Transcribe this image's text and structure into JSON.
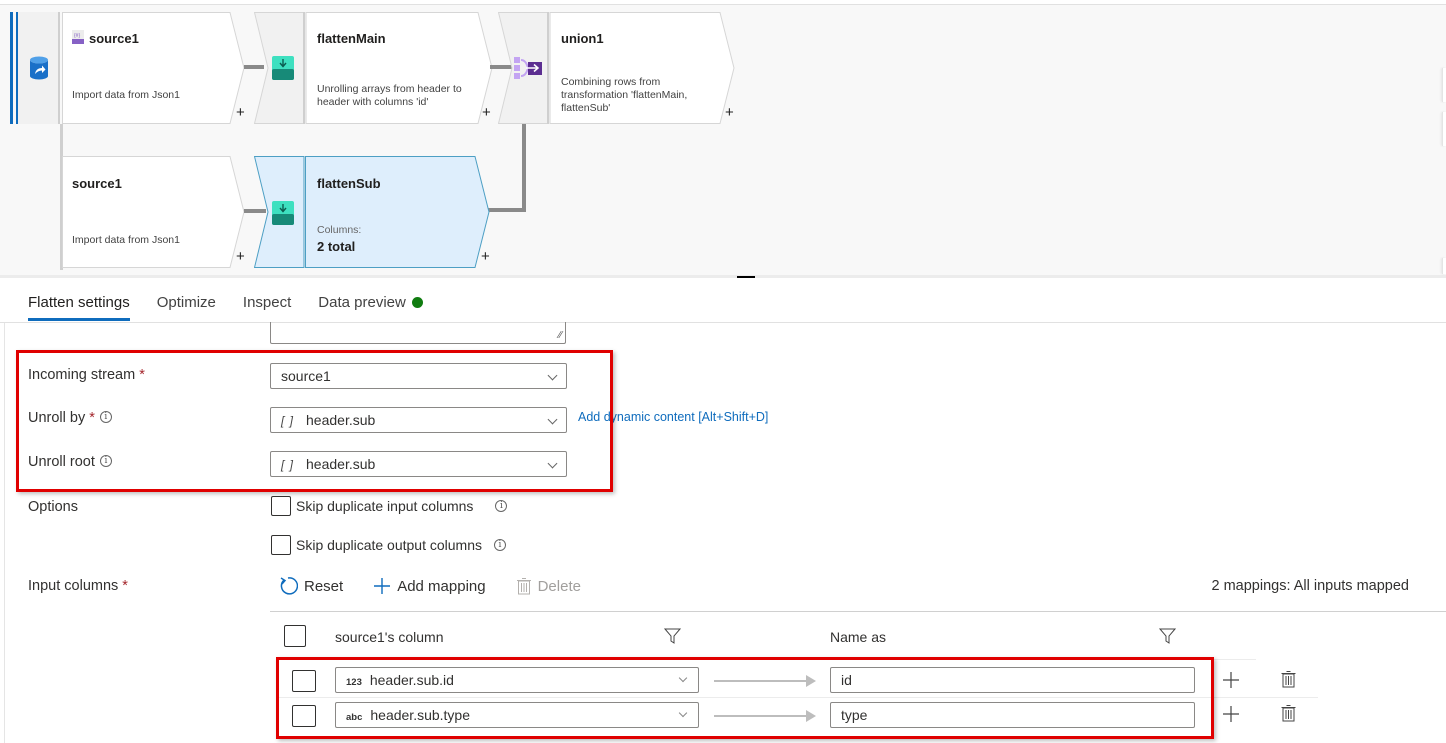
{
  "canvas": {
    "nodes": [
      {
        "id": "source1-main",
        "title": "source1",
        "description": "Import data from Json1",
        "type_icon": "json-dataset-icon"
      },
      {
        "id": "flattenMain",
        "title": "flattenMain",
        "description": "Unrolling arrays from header to header with columns 'id'",
        "type_icon": "flatten-icon"
      },
      {
        "id": "union1",
        "title": "union1",
        "description": "Combining rows from transformation 'flattenMain, flattenSub'",
        "type_icon": "union-icon"
      },
      {
        "id": "source1-branch",
        "title": "source1",
        "description": "Import data from Json1"
      },
      {
        "id": "flattenSub",
        "title": "flattenSub",
        "columns_label": "Columns:",
        "columns_value": "2 total",
        "type_icon": "flatten-icon",
        "selected": true
      }
    ],
    "add_symbol": "+",
    "source_type_icon": "source-database-icon"
  },
  "tabs": [
    {
      "label": "Flatten settings",
      "active": true
    },
    {
      "label": "Optimize",
      "active": false
    },
    {
      "label": "Inspect",
      "active": false
    },
    {
      "label": "Data preview",
      "active": false,
      "status_color": "#107c10"
    }
  ],
  "form": {
    "incoming_stream": {
      "label": "Incoming stream",
      "required_mark": "*",
      "value": "source1"
    },
    "unroll_by": {
      "label": "Unroll by",
      "required_mark": "*",
      "info": "i",
      "type_glyph": "[ ]",
      "value": "header.sub"
    },
    "unroll_root": {
      "label": "Unroll root",
      "info": "i",
      "type_glyph": "[ ]",
      "value": "header.sub"
    },
    "dynamic_content_link": "Add dynamic content [Alt+Shift+D]",
    "options": {
      "label": "Options",
      "skip_duplicate_input": {
        "label": "Skip duplicate input columns",
        "checked": false
      },
      "skip_duplicate_output": {
        "label": "Skip duplicate output columns",
        "checked": false
      }
    },
    "input_columns": {
      "label": "Input columns",
      "required_mark": "*",
      "toolbar": {
        "reset": "Reset",
        "add_mapping": "Add mapping",
        "delete": "Delete"
      },
      "status": "2 mappings: All inputs mapped",
      "headers": {
        "source": "source1's column",
        "name_as": "Name as"
      },
      "rows": [
        {
          "type_glyph": "123",
          "source": "header.sub.id",
          "name_as": "id"
        },
        {
          "type_glyph": "abc",
          "source": "header.sub.type",
          "name_as": "type"
        }
      ]
    }
  },
  "colors": {
    "accent": "#0f6cbd",
    "highlight_box": "#e00000",
    "selected_node_fill": "#deeefc",
    "required": "#a4262c"
  }
}
